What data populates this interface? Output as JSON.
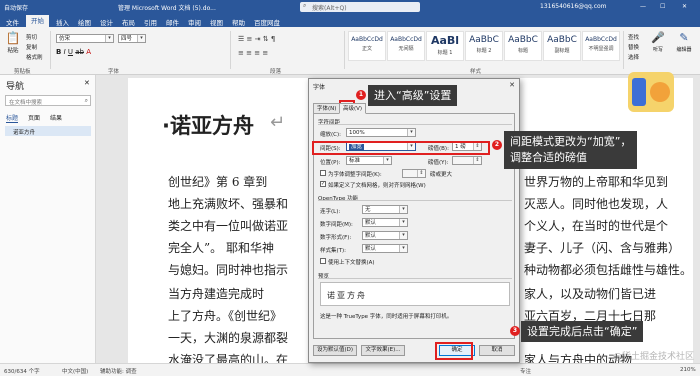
{
  "titlebar": {
    "autosave": "自动保存",
    "doc_title": "管理 Microsoft Word 文档 (5).do...",
    "search_placeholder": "搜索(Alt+Q)",
    "account": "1316540616@qq.com"
  },
  "ribbon_tabs": [
    "文件",
    "开始",
    "插入",
    "绘图",
    "设计",
    "布局",
    "引用",
    "邮件",
    "审阅",
    "视图",
    "帮助",
    "百度网盘"
  ],
  "ribbon": {
    "paste_label": "粘贴",
    "cut": "剪切",
    "copy": "复制",
    "format_painter": "格式刷",
    "clipboard_group": "剪贴板",
    "font_name": "仿宋",
    "font_size": "四号",
    "font_group": "字体",
    "paragraph_group": "段落",
    "styles": [
      {
        "sample": "AaBbCcDd",
        "name": "正文"
      },
      {
        "sample": "AaBbCcDd",
        "name": "无间隔"
      },
      {
        "sample": "AaBl",
        "name": "标题 1"
      },
      {
        "sample": "AaBbC",
        "name": "标题 2"
      },
      {
        "sample": "AaBbC",
        "name": "标题"
      },
      {
        "sample": "AaBbC",
        "name": "副标题"
      },
      {
        "sample": "AaBbCcDd",
        "name": "不明显强调"
      }
    ],
    "styles_group": "样式",
    "find": "查找",
    "replace": "替换",
    "select": "选择",
    "dictation": "听写",
    "editor": "编辑器",
    "reuse": "重用文件"
  },
  "nav": {
    "title": "导航",
    "search_placeholder": "在文档中搜索",
    "tabs": [
      "标题",
      "页面",
      "结果"
    ],
    "items": [
      "诺亚方舟"
    ]
  },
  "document": {
    "heading": "·诺亚方舟",
    "lines": [
      "创世纪》第 6 章到",
      "地上充满败坏、强暴和",
      "类之中有一位叫做诺亚",
      "完全人”。  耶和华神",
      "与媳妇。同时神也指示",
      "当方舟建造完成时",
      "上了方舟。《创世纪》",
      "一天，大渊的泉源都裂",
      "水淹没了最高的山。在"
    ],
    "right_lines": [
      "世界万物的上帝耶和华见到",
      "灭恶人。同时他也发现，人",
      "个义人，在当时的世代是个",
      "妻子、儿子（闪、含与雅弗）",
      "种动物都必须包括雌性与雄性。",
      "家人，以及动物们皆已进",
      "亚六百岁，二月十七日那",
      "",
      "家人与方舟中的动物"
    ],
    "footnote_mark": "[1]"
  },
  "dialog": {
    "title": "字体",
    "tabs": [
      "字体(N)",
      "高级(V)"
    ],
    "spacing_section": "字符间距",
    "scale_label": "缩放(C):",
    "scale_value": "100%",
    "spacing_label": "间距(S):",
    "spacing_value": "加宽",
    "spacing_by_label": "磅值(B):",
    "spacing_by_value": "1 磅",
    "position_label": "位置(P):",
    "position_value": "标准",
    "position_by_label": "磅值(Y):",
    "kerning_label": "为字体调整字间距(K):",
    "kerning_unit": "磅或更大",
    "grid_check": "如果定义了文档网格，则对齐到网格(W)",
    "opentype_section": "OpenType 功能",
    "ligatures_label": "连字(L):",
    "ligatures_value": "无",
    "num_spacing_label": "数字间距(M):",
    "num_spacing_value": "默认",
    "num_forms_label": "数字形式(F):",
    "num_forms_value": "默认",
    "style_sets_label": "样式集(T):",
    "style_sets_value": "默认",
    "contextual_check": "使用上下文替换(A)",
    "preview_section": "预览",
    "preview_text": "诺亚方舟",
    "truetype_note": "这是一种 TrueType 字体，同时适用于屏幕和打印机。",
    "default_button": "设为默认值(D)",
    "effects_button": "文字效果(E)...",
    "ok_button": "确定",
    "cancel_button": "取消"
  },
  "annotations": [
    {
      "num": "1",
      "text": "进入“高级”设置"
    },
    {
      "num": "2",
      "text": "间距模式更改为“加宽”，\n调整合适的磅值"
    },
    {
      "num": "3",
      "text": "设置完成后点击“确定”"
    }
  ],
  "accent_color": "#2b579a",
  "annotation_color": "#e02020",
  "statusbar": {
    "page": "第 1 页，共 1 页",
    "words": "630/634 个字",
    "language": "中文(中国)",
    "accessibility": "辅助功能: 调查",
    "focus": "专注",
    "zoom": "210%"
  },
  "watermark": "@稀土掘金技术社区"
}
